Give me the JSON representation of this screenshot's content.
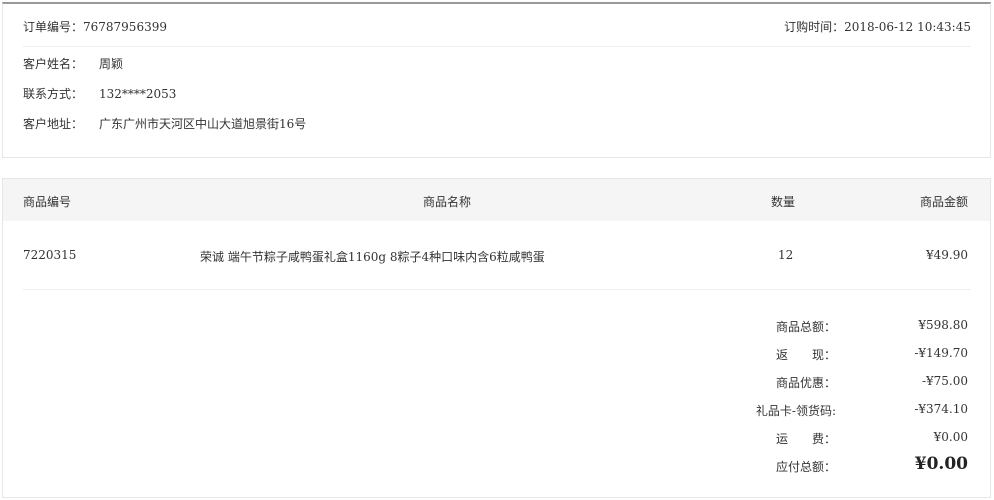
{
  "order": {
    "number_text": "订单编号：76787956399",
    "time_text": "订购时间：2018-06-12 10:43:45"
  },
  "customer": {
    "name_label": "客户姓名：",
    "name_value": "周颖",
    "contact_label": "联系方式：",
    "contact_value": "132****2053",
    "address_label": "客户地址：",
    "address_value": "广东广州市天河区中山大道旭景街16号"
  },
  "table": {
    "headers": {
      "sku": "商品编号",
      "name": "商品名称",
      "qty": "数量",
      "amount": "商品金额"
    },
    "items": [
      {
        "sku": "7220315",
        "name": "荣诚 端午节粽子咸鸭蛋礼盒1160g 8粽子4种口味内含6粒咸鸭蛋",
        "qty": "12",
        "amount": "¥49.90"
      }
    ]
  },
  "summary": [
    {
      "label": "商品总额：",
      "value": "¥598.80"
    },
    {
      "label": "返　　现：",
      "value": "-¥149.70"
    },
    {
      "label": "商品优惠：",
      "value": "-¥75.00"
    },
    {
      "label": "礼品卡-领货码:",
      "value": "-¥374.10"
    },
    {
      "label": "运　　费：",
      "value": "¥0.00"
    },
    {
      "label": "应付总额：",
      "value": "¥0.00"
    }
  ]
}
